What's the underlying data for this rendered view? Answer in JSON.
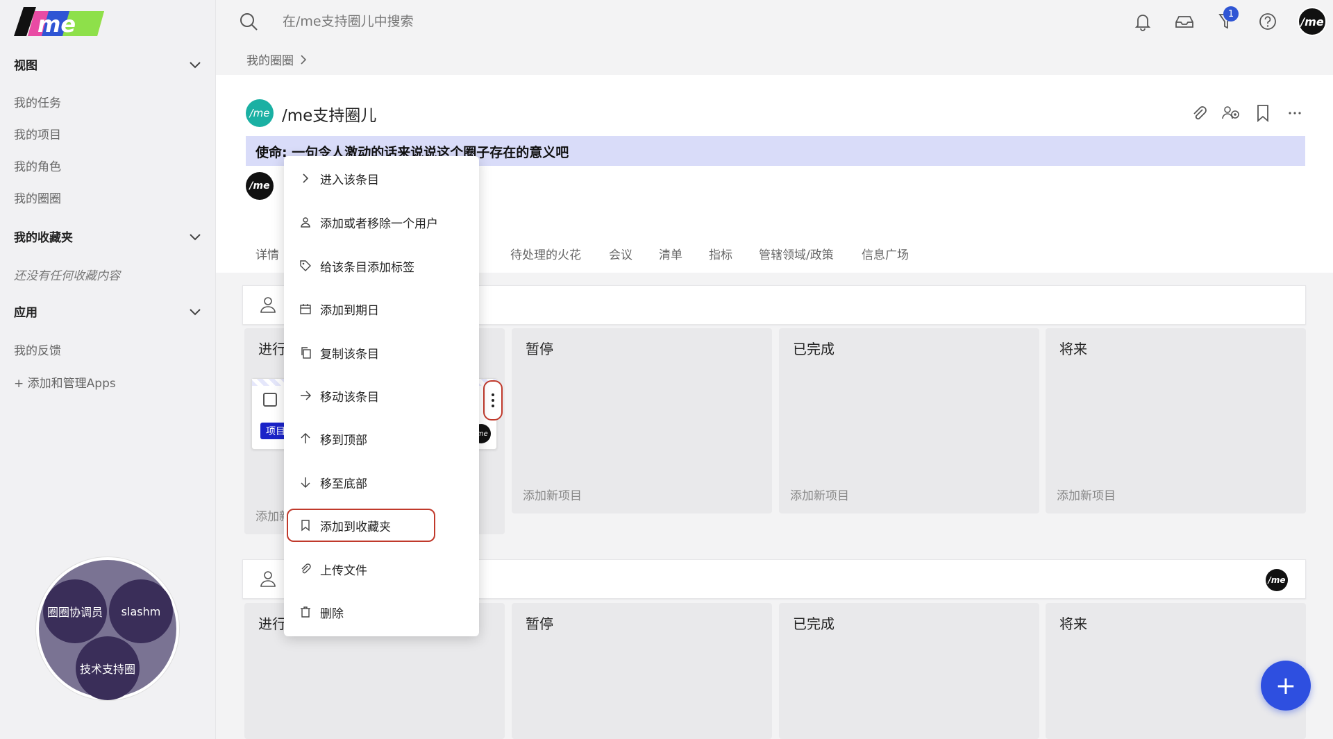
{
  "app": {
    "logo_text": "/me"
  },
  "sidebar": {
    "sections": [
      {
        "label": "视图"
      },
      {
        "label": "我的收藏夹"
      },
      {
        "label": "应用"
      }
    ],
    "view_items": [
      "我的任务",
      "我的项目",
      "我的角色",
      "我的圈圈"
    ],
    "favorites_empty": "还没有任何收藏内容",
    "app_items": [
      "我的反馈",
      "+ 添加和管理Apps"
    ],
    "venn": {
      "labels": [
        "圈圈协调员",
        "slashm",
        "技术支持圈"
      ]
    }
  },
  "topbar": {
    "search_placeholder": "在/me支持圈儿中搜索",
    "notification_badge": "1",
    "icons": [
      "bell-icon",
      "inbox-icon",
      "filter-icon",
      "help-icon"
    ]
  },
  "breadcrumb": {
    "item": "我的圈圈"
  },
  "circle": {
    "logo_text": "/me",
    "title": "/me支持圈儿",
    "mission": "使命: 一句令人激动的话来说说这个圈子存在的意义吧"
  },
  "tabs": [
    "详情",
    "待处理的火花",
    "会议",
    "清单",
    "指标",
    "管辖领域/政策",
    "信息广场"
  ],
  "kanban": {
    "columns": [
      "进行",
      "暂停",
      "已完成",
      "将来"
    ],
    "add_new_label": "添加新项目",
    "add_new_partial": "添加新",
    "card_tag": "项目"
  },
  "context_menu": {
    "items": [
      {
        "label": "进入该条目",
        "icon": "chevron-right-icon"
      },
      {
        "label": "添加或者移除一个用户",
        "icon": "user-icon"
      },
      {
        "label": "给该条目添加标签",
        "icon": "tag-icon"
      },
      {
        "label": "添加到期日",
        "icon": "calendar-icon"
      },
      {
        "label": "复制该条目",
        "icon": "copy-icon"
      },
      {
        "label": "移动该条目",
        "icon": "arrow-right-icon"
      },
      {
        "label": "移到顶部",
        "icon": "arrow-up-icon"
      },
      {
        "label": "移至底部",
        "icon": "arrow-down-icon"
      },
      {
        "label": "添加到收藏夹",
        "icon": "bookmark-icon"
      },
      {
        "label": "上传文件",
        "icon": "paperclip-icon"
      },
      {
        "label": "删除",
        "icon": "trash-icon"
      }
    ]
  },
  "fab": {
    "label": "+"
  },
  "colors": {
    "accent": "#2e4fe0",
    "mission_bg": "#d9dcf9",
    "highlight_border": "#c0392b",
    "tag_bg": "#1a23c8"
  }
}
